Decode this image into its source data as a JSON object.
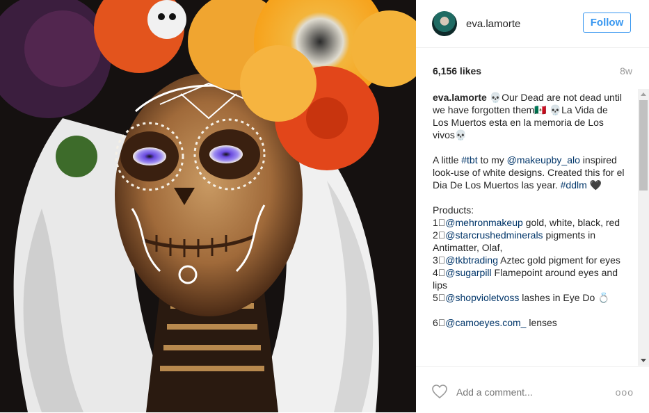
{
  "post": {
    "username": "eva.lamorte",
    "follow_label": "Follow",
    "likes": "6,156 likes",
    "time_ago": "8w",
    "caption": {
      "author": "eva.lamorte",
      "p1": "💀Our Dead are not dead until we have forgotten them🇲🇽 💀La Vida de Los Muertos esta en la memoria de Los vivos💀",
      "p2_a": "A little ",
      "p2_tag1": "#tbt",
      "p2_b": " to my ",
      "p2_mention": "@makeupby_alo",
      "p2_c": " inspired look-use of white designs. Created this for el Dia De Los Muertos las year. ",
      "p2_tag2": "#ddlm",
      "p2_d": " 🖤",
      "products_label": "Products:",
      "items": [
        {
          "num": "1⃣",
          "mention": "@mehronmakeup",
          "text": " gold, white, black, red"
        },
        {
          "num": "2⃣",
          "mention": "@starcrushedminerals",
          "text": " pigments in Antimatter, Olaf,"
        },
        {
          "num": "3⃣",
          "mention": "@tkbtrading",
          "text": " Aztec gold pigment for eyes"
        },
        {
          "num": "4⃣",
          "mention": "@sugarpill",
          "text": " Flamepoint around eyes and lips"
        },
        {
          "num": "5⃣",
          "mention": "@shopvioletvoss",
          "text": " lashes in Eye Do 💍"
        }
      ],
      "item6": {
        "num": "6⃣",
        "mention": "@camoeyes.com_",
        "text": " lenses"
      }
    },
    "comment_placeholder": "Add a comment...",
    "more_label": "ooo"
  },
  "icons": {
    "like": "heart-outline-icon",
    "more": "ellipsis-icon"
  },
  "colors": {
    "link": "#003569",
    "follow": "#3897f0",
    "muted": "#999999"
  }
}
